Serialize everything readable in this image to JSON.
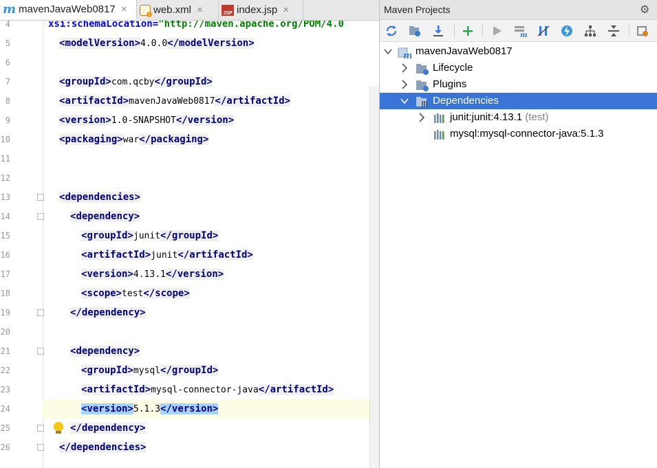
{
  "tabs": [
    {
      "label": "mavenJavaWeb0817",
      "icon": "maven-m-icon",
      "active": true
    },
    {
      "label": "web.xml",
      "icon": "xml-file-icon",
      "active": false
    },
    {
      "label": "index.jsp",
      "icon": "jsp-file-icon",
      "active": false
    }
  ],
  "tab_close": "×",
  "editor": {
    "lines": [
      {
        "num": "4",
        "prefix": "",
        "attr": "xsi:schemaLocation=",
        "attr_value": "\"http://maven.apache.org/POM/4.0"
      },
      {
        "num": "5",
        "tag": "modelVersion",
        "value": "4.0.0"
      },
      {
        "num": "6"
      },
      {
        "num": "7",
        "tag": "groupId",
        "value": "com.qcby"
      },
      {
        "num": "8",
        "tag": "artifactId",
        "value": "mavenJavaWeb0817"
      },
      {
        "num": "9",
        "tag": "version",
        "value": "1.0-SNAPSHOT"
      },
      {
        "num": "10",
        "tag": "packaging",
        "value": "war"
      },
      {
        "num": "11"
      },
      {
        "num": "12"
      },
      {
        "num": "13",
        "open": "dependencies"
      },
      {
        "num": "14",
        "open": "dependency"
      },
      {
        "num": "15",
        "tag": "groupId",
        "value": "junit"
      },
      {
        "num": "16",
        "tag": "artifactId",
        "value": "junit"
      },
      {
        "num": "17",
        "tag": "version",
        "value": "4.13.1"
      },
      {
        "num": "18",
        "tag": "scope",
        "value": "test"
      },
      {
        "num": "19",
        "close": "dependency"
      },
      {
        "num": "20"
      },
      {
        "num": "21",
        "open": "dependency"
      },
      {
        "num": "22",
        "tag": "groupId",
        "value": "mysql"
      },
      {
        "num": "23",
        "tag": "artifactId",
        "value": "mysql-connector-java"
      },
      {
        "num": "24",
        "tag": "version",
        "value": "5.1.3"
      },
      {
        "num": "25",
        "close": "dependency"
      },
      {
        "num": "26",
        "close": "dependencies"
      }
    ]
  },
  "maven_panel": {
    "title": "Maven Projects",
    "toolbar": [
      "reimport-icon",
      "generate-sources-icon",
      "download-icon",
      "add-icon",
      "run-icon",
      "execute-goal-icon",
      "toggle-offline-icon",
      "skip-tests-icon",
      "show-dependencies-icon",
      "collapse-all-icon",
      "settings-icon"
    ],
    "tree": {
      "project": "mavenJavaWeb0817",
      "nodes": [
        {
          "label": "Lifecycle"
        },
        {
          "label": "Plugins"
        },
        {
          "label": "Dependencies"
        }
      ],
      "dependencies": [
        {
          "label": "junit:junit:4.13.1",
          "scope": "(test)"
        },
        {
          "label": "mysql:mysql-connector-java:5.1.3",
          "scope": ""
        }
      ]
    }
  },
  "colors": {
    "selection": "#3875d6",
    "tag": "#000080",
    "current_line": "#fdfce4",
    "tag_highlight": "#a6d2ff"
  }
}
